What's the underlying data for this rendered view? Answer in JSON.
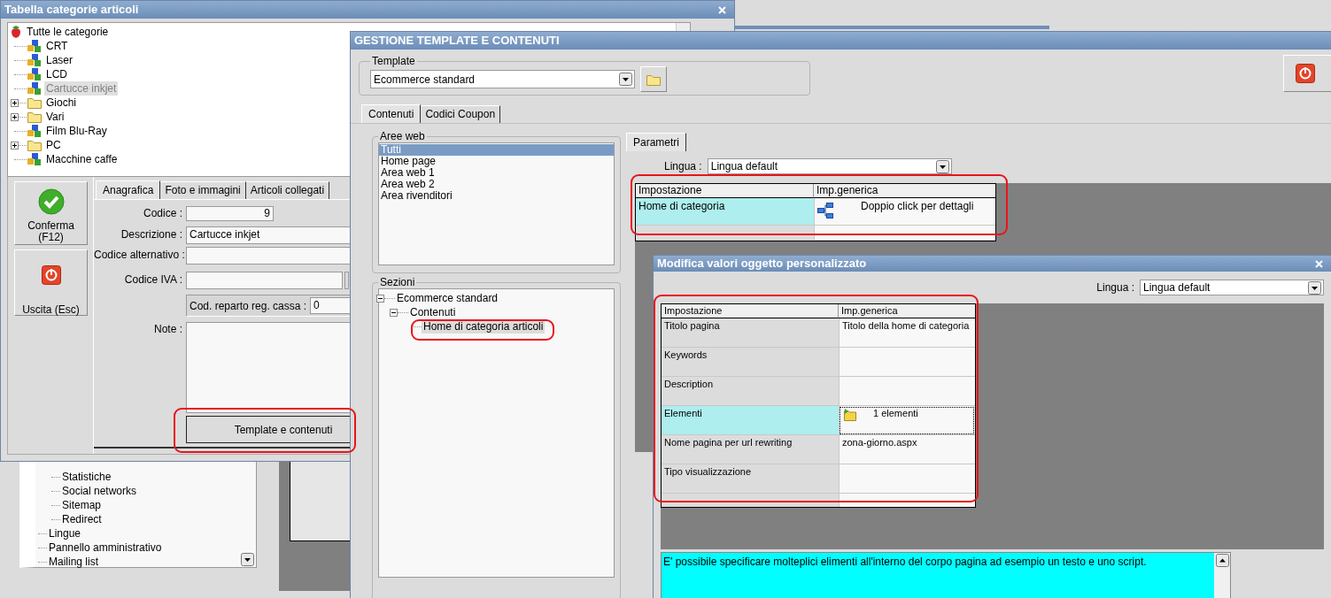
{
  "background_window": {
    "tree": [
      {
        "children": [
          {
            "label": "Statistiche"
          },
          {
            "label": "Social networks"
          },
          {
            "label": "Sitemap"
          },
          {
            "label": "Redirect"
          }
        ]
      },
      {
        "label": "Lingue"
      },
      {
        "label": "Pannello amministrativo"
      },
      {
        "label": "Mailing list"
      }
    ]
  },
  "category_window": {
    "title": "Tabella categorie articoli",
    "tree": {
      "label": "Tutte le categorie",
      "children": [
        {
          "label": "CRT",
          "kind": "category",
          "selected": false
        },
        {
          "label": "Laser",
          "kind": "category",
          "selected": false
        },
        {
          "label": "LCD",
          "kind": "category",
          "selected": false
        },
        {
          "label": "Cartucce inkjet",
          "kind": "category",
          "selected": true
        },
        {
          "label": "Giochi",
          "kind": "folder",
          "expanded": false,
          "selected": false
        },
        {
          "label": "Vari",
          "kind": "folder",
          "expanded": false,
          "selected": false
        },
        {
          "label": "Film Blu-Ray",
          "kind": "category",
          "selected": false
        },
        {
          "label": "PC",
          "kind": "folder",
          "expanded": false,
          "selected": false
        },
        {
          "label": "Macchine caffe",
          "kind": "category",
          "selected": false
        }
      ]
    },
    "side_buttons": [
      {
        "label": "Conferma (F12)",
        "kind": "confirm"
      },
      {
        "label": "Uscita (Esc)",
        "kind": "exit"
      }
    ],
    "tabs": [
      {
        "label": "Anagrafica",
        "selected": true
      },
      {
        "label": "Foto e immagini",
        "selected": false
      },
      {
        "label": "Articoli collegati",
        "selected": false
      }
    ],
    "fields": [
      {
        "label": "Codice :",
        "value": "9",
        "kind": "number"
      },
      {
        "label": "Descrizione :",
        "value": "Cartucce inkjet",
        "kind": "text"
      },
      {
        "label": "Codice alternativo :",
        "kind": "alt"
      },
      {
        "label": "Codice IVA :",
        "kind": "lookup"
      },
      {
        "label": "Cod. reparto reg. cassa :",
        "value": "0",
        "kind": "inset"
      },
      {
        "label": "Note :",
        "kind": "memo"
      }
    ],
    "template_button": "Template e contenuti"
  },
  "template_window": {
    "title": "GESTIONE TEMPLATE E CONTENUTI",
    "template_group": {
      "legend": "Template",
      "value": "Ecommerce standard"
    },
    "tabs": [
      {
        "label": "Contenuti",
        "selected": true
      },
      {
        "label": "Codici Coupon",
        "selected": false
      }
    ],
    "web_areas": {
      "legend": "Aree web",
      "items": [
        {
          "label": "Tutti",
          "selected": true
        },
        {
          "label": "Home page",
          "selected": false
        },
        {
          "label": "Area web 1",
          "selected": false
        },
        {
          "label": "Area web 2",
          "selected": false
        },
        {
          "label": "Area rivenditori",
          "selected": false
        }
      ]
    },
    "sections": {
      "legend": "Sezioni",
      "tree": [
        {
          "label": "Ecommerce standard",
          "expanded": true,
          "selected": false,
          "children": [
            {
              "label": "Contenuti",
              "expanded": true,
              "selected": false,
              "children": [
                {
                  "label": "Home di categoria articoli",
                  "selected": true
                }
              ]
            }
          ]
        }
      ]
    },
    "parameter_tabs": [
      {
        "label": "Parametri",
        "selected": true
      }
    ],
    "language": {
      "label": "Lingua :",
      "value": "Lingua default"
    },
    "grid": {
      "columns": [
        "Impostazione",
        "Imp.generica"
      ],
      "rows": [
        {
          "setting": "Home di categoria",
          "value": "Doppio click per dettagli",
          "kind": "tree",
          "selected": true
        }
      ]
    }
  },
  "edit_dialog": {
    "title": "Modifica valori oggetto personalizzato",
    "language": {
      "label": "Lingua :",
      "value": "Lingua default"
    },
    "grid": {
      "columns": [
        "Impostazione",
        "Imp.generica"
      ],
      "rows": [
        {
          "setting": "Titolo pagina",
          "value": "Titolo della home di categoria",
          "selected": false
        },
        {
          "setting": "Keywords",
          "selected": false
        },
        {
          "setting": "Description",
          "selected": false
        },
        {
          "setting": "Elementi",
          "value": "1 elementi",
          "kind": "folder",
          "selected": true
        },
        {
          "setting": "Nome pagina per url rewriting",
          "value": "zona-giorno.aspx",
          "selected": false
        },
        {
          "setting": "Tipo visualizzazione",
          "selected": false
        }
      ]
    },
    "help_text": "E' possibile specificare molteplici elimenti all'interno del corpo pagina ad esempio un testo e uno script."
  }
}
